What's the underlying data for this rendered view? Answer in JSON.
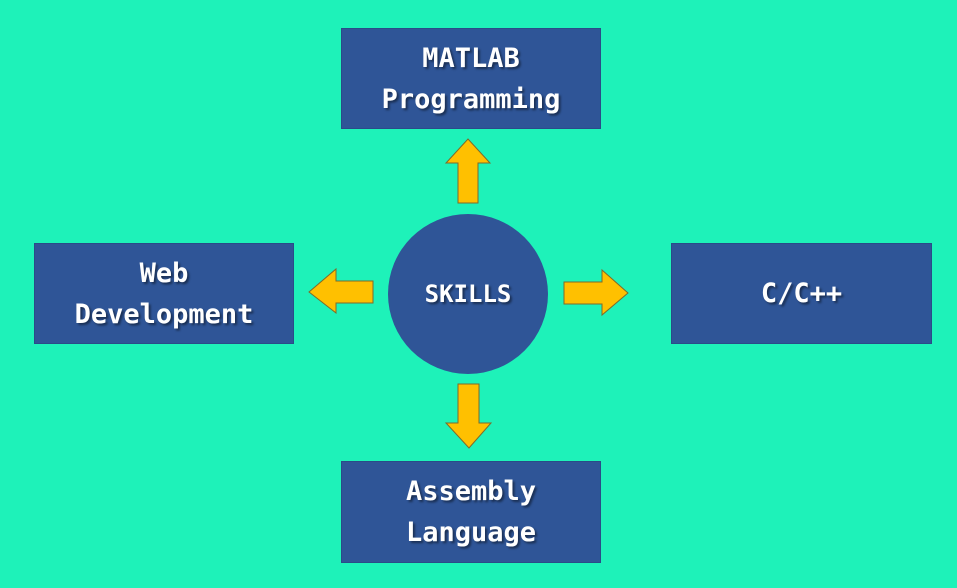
{
  "center": {
    "label": "SKILLS"
  },
  "skills": {
    "top": {
      "line1": "MATLAB",
      "line2": "Programming"
    },
    "left": {
      "line1": "Web",
      "line2": "Development"
    },
    "right": {
      "line1": "C/C++"
    },
    "bottom": {
      "line1": "Assembly",
      "line2": "Language"
    }
  },
  "colors": {
    "background": "#1ef2b9",
    "box": "#2f5597",
    "arrow": "#ffc000",
    "text": "#ffffff"
  },
  "icons": [
    "arrow-up-icon",
    "arrow-left-icon",
    "arrow-right-icon",
    "arrow-down-icon"
  ]
}
